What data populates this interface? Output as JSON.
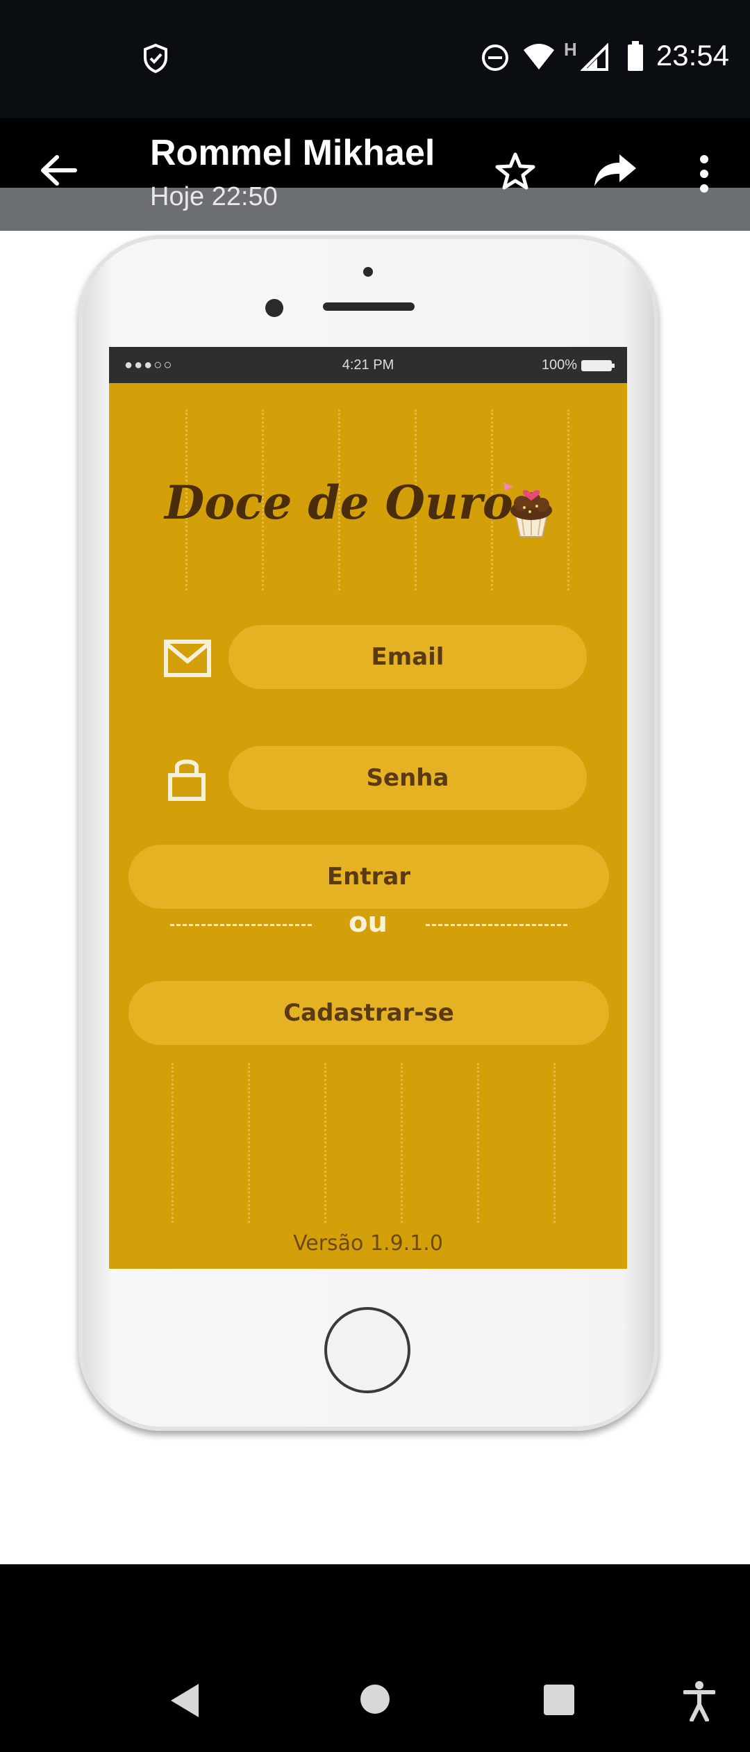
{
  "status_bar": {
    "time": "23:54",
    "network_type": "H",
    "icons": [
      "shield-check-icon",
      "do-not-disturb-icon",
      "wifi-icon",
      "signal-icon",
      "battery-icon"
    ]
  },
  "header": {
    "title": "Rommel Mikhael",
    "subtitle": "Hoje 22:50",
    "icons": [
      "back-arrow-icon",
      "star-icon",
      "share-icon",
      "more-vertical-icon"
    ]
  },
  "mockup": {
    "inner_status": {
      "signal": "●●●○○",
      "time": "4:21 PM",
      "battery": "100%"
    },
    "app_name": "Doce de Ouro",
    "email_placeholder": "Email",
    "password_placeholder": "Senha",
    "login_label": "Entrar",
    "divider_text": "ou",
    "signup_label": "Cadastrar-se",
    "version": "Versão 1.9.1.0",
    "icons": [
      "cupcake-icon",
      "mail-icon",
      "lock-icon"
    ]
  },
  "nav_bar": {
    "icons": [
      "back-triangle-icon",
      "home-circle-icon",
      "recents-square-icon",
      "accessibility-icon"
    ]
  },
  "colors": {
    "app_background": "#d4a00a",
    "pill": "#e5b224",
    "pill_text": "#5a3a12"
  }
}
